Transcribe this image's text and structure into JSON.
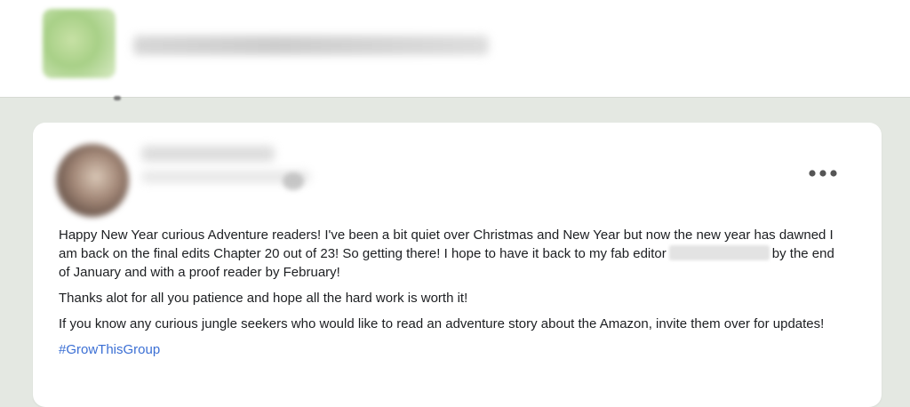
{
  "group_header": {
    "name": "",
    "thumb_icon": "group-cover-image"
  },
  "post": {
    "author": "",
    "more_icon": "more-options-icon",
    "paragraphs": {
      "p1_before": "Happy New Year curious Adventure readers! I've been a bit quiet over Christmas and New Year but now the new year has dawned I am back on the final edits Chapter 20 out of 23! So getting there! I hope to have it back to my fab editor",
      "p1_after": "by the end of January and with a proof reader by February!",
      "p2": "Thanks alot for all you patience and hope all the hard work is worth it!",
      "p3": "If you know any curious jungle seekers who would like to read an adventure story about the Amazon, invite them over for updates!"
    },
    "hashtag": "#GrowThisGroup"
  },
  "colors": {
    "page_bg": "#e4e8e2",
    "card_bg": "#ffffff",
    "text": "#1c1e21",
    "hashtag": "#3b6fd4"
  }
}
